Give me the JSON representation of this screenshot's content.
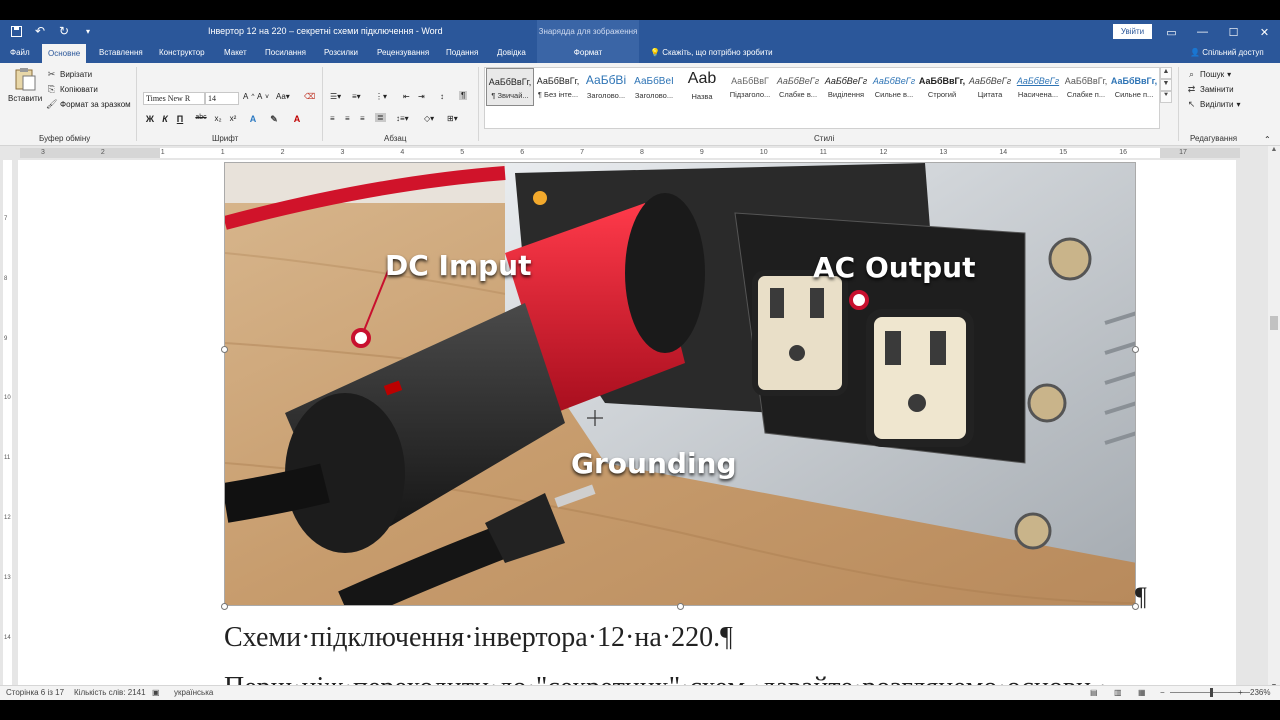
{
  "window": {
    "title": "Інвертор 12 на 220 – секретні схеми підключення  -  Word",
    "tool_header": "Знарядда для зображення",
    "sign_in": "Увійти"
  },
  "tabs": [
    {
      "label": "Файл"
    },
    {
      "label": "Основне"
    },
    {
      "label": "Вставлення"
    },
    {
      "label": "Конструктор"
    },
    {
      "label": "Макет"
    },
    {
      "label": "Посилання"
    },
    {
      "label": "Розсилки"
    },
    {
      "label": "Рецензування"
    },
    {
      "label": "Подання"
    },
    {
      "label": "Довідка"
    },
    {
      "label": "Формат"
    }
  ],
  "tell_me": "Скажіть, що потрібно зробити",
  "share": "Спільний доступ",
  "clipboard": {
    "paste": "Вставити",
    "cut": "Вирізати",
    "copy": "Копіювати",
    "format_painter": "Формат за зразком",
    "label": "Буфер обміну"
  },
  "font": {
    "family": "Times New R",
    "size": "14",
    "label": "Шрифт"
  },
  "paragraph": {
    "label": "Абзац"
  },
  "styles": {
    "label": "Стилі",
    "items": [
      {
        "sample": "АаБбВвГг,",
        "name": "¶ Звичай..."
      },
      {
        "sample": "АаБбВвГг,",
        "name": "¶ Без інте..."
      },
      {
        "sample": "АаБбВі",
        "name": "Заголово..."
      },
      {
        "sample": "АаБбВеІ",
        "name": "Заголово..."
      },
      {
        "sample": "Aab",
        "name": "Назва"
      },
      {
        "sample": "АаБбВвГ",
        "name": "Підзаголо..."
      },
      {
        "sample": "АаБбВеГг",
        "name": "Слабке в..."
      },
      {
        "sample": "АаБбВеГг",
        "name": "Виділення"
      },
      {
        "sample": "АаБбВеГг",
        "name": "Сильне в..."
      },
      {
        "sample": "АаБбВвГг,",
        "name": "Строгий"
      },
      {
        "sample": "АаБбВеГг",
        "name": "Цитата"
      },
      {
        "sample": "АаБбВеГг",
        "name": "Насичена..."
      },
      {
        "sample": "АаБбВвГг,",
        "name": "Слабке п..."
      },
      {
        "sample": "АаБбВвГг,",
        "name": "Сильне п..."
      }
    ]
  },
  "editing": {
    "find": "Пошук",
    "replace": "Замінити",
    "select": "Виділити",
    "label": "Редагування"
  },
  "ruler_numbers": [
    "3",
    "2",
    "1",
    "1",
    "2",
    "3",
    "4",
    "5",
    "6",
    "7",
    "8",
    "9",
    "10",
    "11",
    "12",
    "13",
    "14",
    "15",
    "16",
    "17"
  ],
  "vruler_numbers": [
    "7",
    "8",
    "9",
    "10",
    "11",
    "12",
    "13",
    "14",
    "15"
  ],
  "image_labels": {
    "dc": "DC Imput",
    "ac": "AC Output",
    "ground": "Grounding"
  },
  "document": {
    "pilcrow": "¶",
    "heading": "Схеми·підключення·інвертора·12·на·220.¶",
    "next_line": "Перш·ніж·переходити·до·\"секретних\"·схем,·давайте·розглянемо·основи.·"
  },
  "status": {
    "page": "Сторінка 6 із 17",
    "words": "Кількість слів: 2141",
    "language": "українська",
    "zoom": "236%"
  },
  "colors": {
    "brand": "#2b579a",
    "accent_red": "#c8102e"
  }
}
